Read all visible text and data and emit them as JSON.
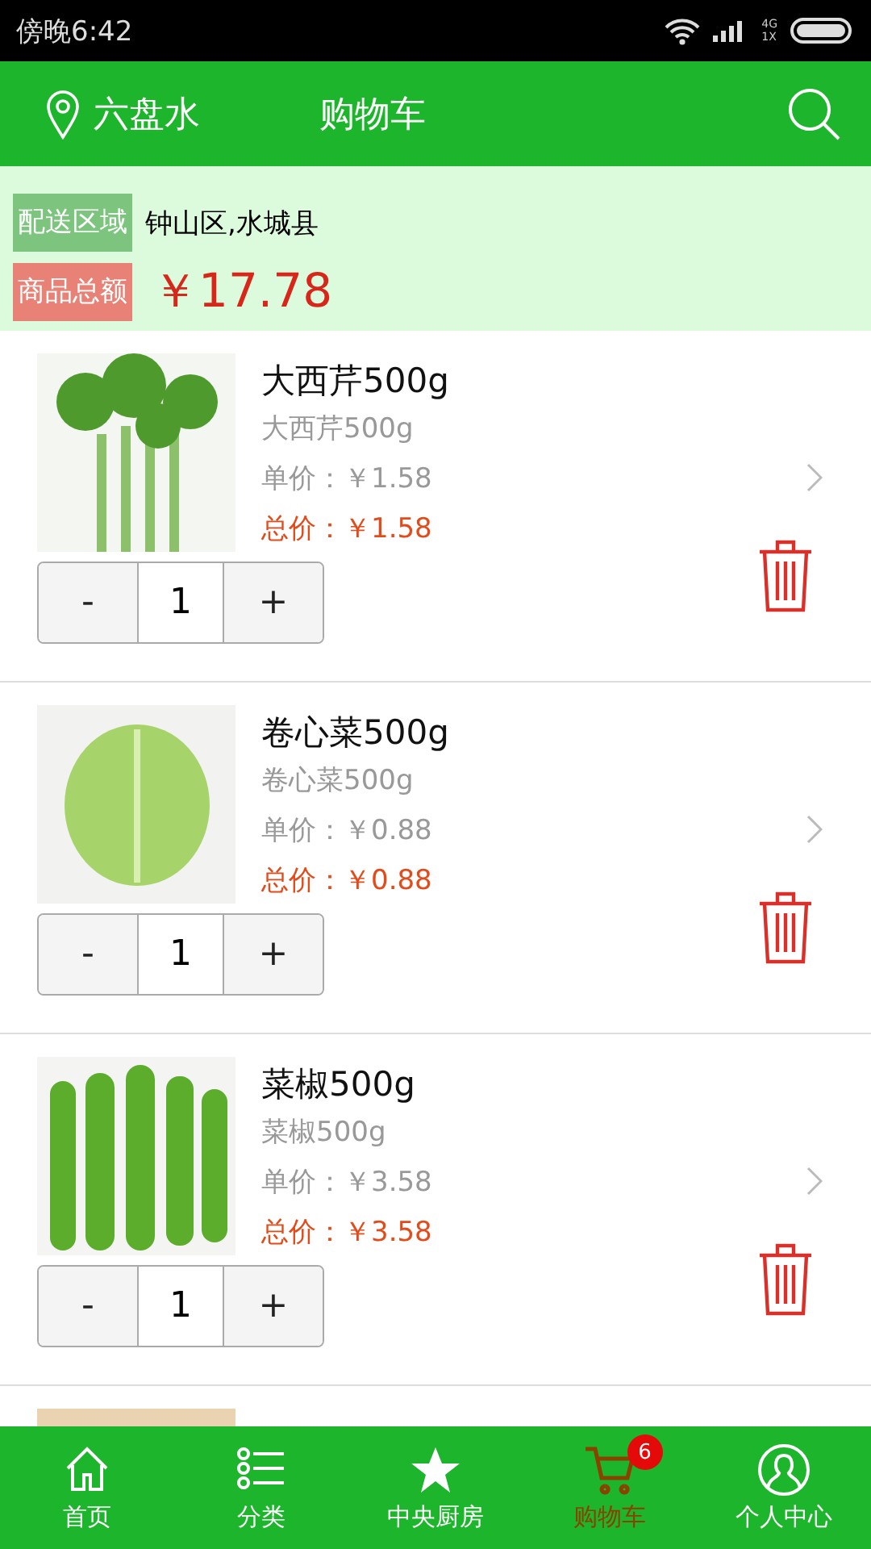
{
  "status_bar": {
    "time": "傍晚6:42",
    "network": "4G\n1X"
  },
  "header": {
    "location": "六盘水",
    "title": "购物车"
  },
  "summary": {
    "area_label": "配送区域",
    "area_value": "钟山区,水城县",
    "total_label": "商品总额",
    "total_value": "￥17.78"
  },
  "items": [
    {
      "name": "大西芹500g",
      "subtitle": "大西芹500g",
      "unit_price": "单价：￥1.58",
      "total_price": "总价：￥1.58",
      "quantity": "1",
      "minus": "-",
      "plus": "+",
      "kind": "celery"
    },
    {
      "name": "卷心菜500g",
      "subtitle": "卷心菜500g",
      "unit_price": "单价：￥0.88",
      "total_price": "总价：￥0.88",
      "quantity": "1",
      "minus": "-",
      "plus": "+",
      "kind": "cabbage"
    },
    {
      "name": "菜椒500g",
      "subtitle": "菜椒500g",
      "unit_price": "单价：￥3.58",
      "total_price": "总价：￥3.58",
      "quantity": "1",
      "minus": "-",
      "plus": "+",
      "kind": "pepper"
    },
    {
      "kind": "partial"
    }
  ],
  "tabs": [
    {
      "label": "首页",
      "kind": "home",
      "selected": false
    },
    {
      "label": "分类",
      "kind": "list",
      "selected": false
    },
    {
      "label": "中央厨房",
      "kind": "star",
      "selected": false
    },
    {
      "label": "购物车",
      "kind": "cart",
      "selected": true,
      "badge": "6"
    },
    {
      "label": "个人中心",
      "kind": "user",
      "selected": false
    }
  ]
}
